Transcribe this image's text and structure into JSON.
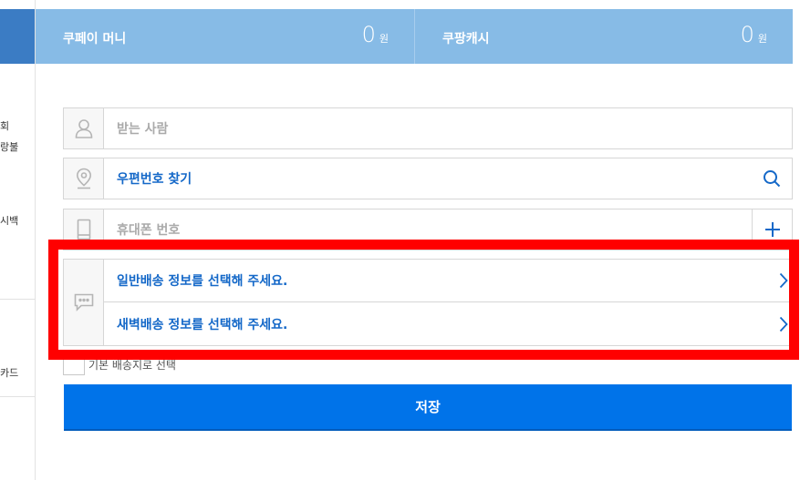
{
  "sidebar": {
    "items": [
      "회",
      "랑불",
      "시백",
      "카드"
    ]
  },
  "balance": [
    {
      "label": "쿠페이 머니",
      "value": "0",
      "unit": "원"
    },
    {
      "label": "쿠팡캐시",
      "value": "0",
      "unit": "원"
    }
  ],
  "form": {
    "recipient_placeholder": "받는 사람",
    "zipcode_label": "우편번호 찾기",
    "phone_placeholder": "휴대폰 번호",
    "normal_delivery": "일반배송 정보를 선택해 주세요.",
    "dawn_delivery": "새벽배송 정보를 선택해 주세요.",
    "default_address_label": "기본 배송지로 선택",
    "save_label": "저장"
  },
  "icons": {
    "recipient": "person-icon",
    "zipcode": "location-pin-icon",
    "search": "search-icon",
    "phone": "phone-icon",
    "add": "plus-icon",
    "delivery": "speech-bubble-icon",
    "chevron": "chevron-right-icon"
  },
  "colors": {
    "header_bg": "#87bbe6",
    "sidebar_accent": "#3b7cc4",
    "link": "#1468c8",
    "save_button": "#0073e9",
    "highlight": "#ff0000"
  }
}
